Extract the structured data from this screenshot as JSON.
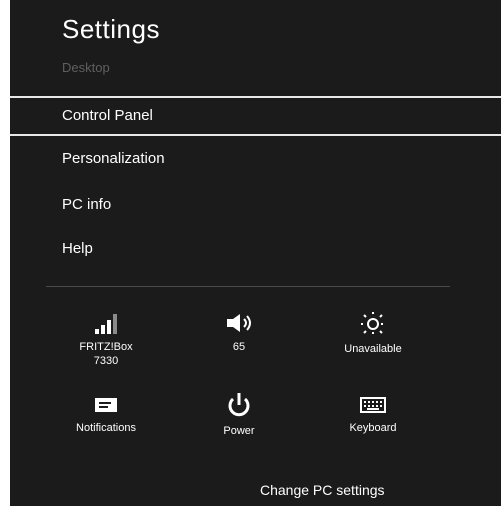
{
  "header": {
    "title": "Settings",
    "context": "Desktop"
  },
  "menu": {
    "items": [
      {
        "label": "Control Panel",
        "selected": true
      },
      {
        "label": "Personalization"
      },
      {
        "label": "PC info"
      },
      {
        "label": "Help"
      }
    ]
  },
  "quick_settings": {
    "network": {
      "icon": "signal-bars-icon",
      "label": "FRITZ!Box\n7330"
    },
    "volume": {
      "icon": "speaker-icon",
      "label": "65"
    },
    "brightness": {
      "icon": "sun-icon",
      "label": "Unavailable"
    },
    "notifications": {
      "icon": "notifications-icon",
      "label": "Notifications"
    },
    "power": {
      "icon": "power-icon",
      "label": "Power"
    },
    "keyboard": {
      "icon": "keyboard-icon",
      "label": "Keyboard"
    }
  },
  "footer": {
    "link": "Change PC settings"
  },
  "colors": {
    "background": "#1b1b1b",
    "text": "#ffffff",
    "muted": "#5f5f5f",
    "highlight_border": "#e8e8e8"
  }
}
